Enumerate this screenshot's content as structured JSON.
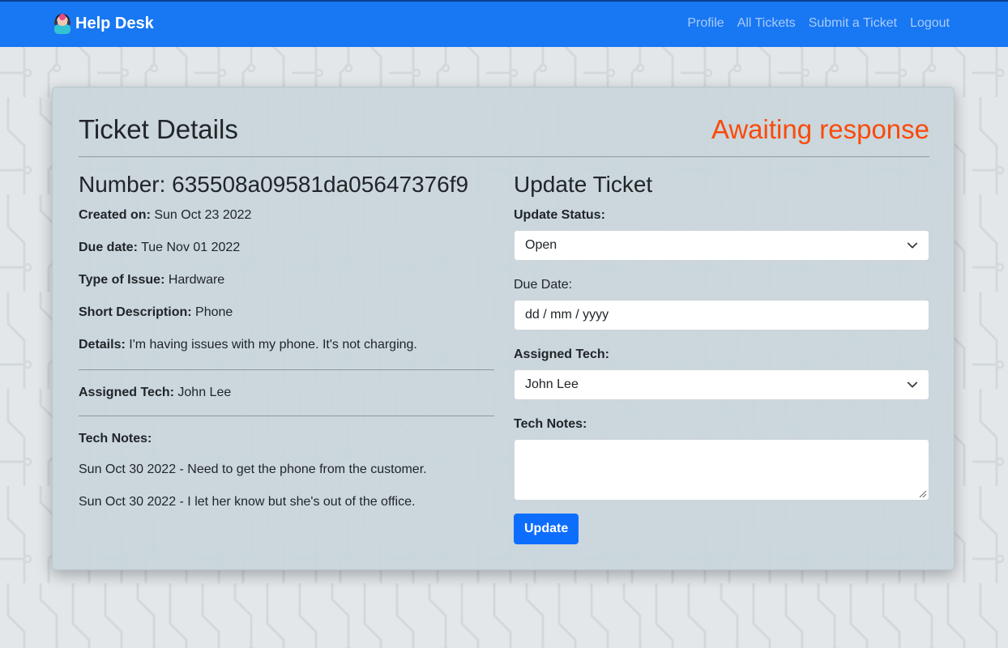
{
  "navbar": {
    "brand": "Help Desk",
    "links": [
      "Profile",
      "All Tickets",
      "Submit a Ticket",
      "Logout"
    ]
  },
  "ticket": {
    "title": "Ticket Details",
    "status": "Awaiting response",
    "number_label": "Number:",
    "number": "635508a09581da05647376f9",
    "created_label": "Created on:",
    "created": "Sun Oct 23 2022",
    "due_label": "Due date:",
    "due": "Tue Nov 01 2022",
    "type_label": "Type of Issue:",
    "type": "Hardware",
    "short_label": "Short Description:",
    "short": "Phone",
    "details_label": "Details:",
    "details": "I'm having issues with my phone. It's not charging.",
    "tech_label": "Assigned Tech:",
    "tech": "John Lee",
    "notes_label": "Tech Notes:",
    "notes": [
      "Sun Oct 30 2022 - Need to get the phone from the customer.",
      "Sun Oct 30 2022 - I let her know but she's out of the office."
    ]
  },
  "form": {
    "title": "Update Ticket",
    "status_label": "Update Status:",
    "status_value": "Open",
    "due_label": "Due Date:",
    "due_placeholder": "dd / mm / yyyy",
    "tech_label": "Assigned Tech:",
    "tech_value": "John Lee",
    "notes_label": "Tech Notes:",
    "notes_value": "",
    "submit_label": "Update"
  },
  "colors": {
    "navbar": "#1877f2",
    "status": "#fa4a0b",
    "button": "#0d6efd"
  },
  "icons": {
    "brand": "help-desk-person-icon",
    "select": "chevron-down-icon",
    "resize": "resize-handle-icon"
  }
}
